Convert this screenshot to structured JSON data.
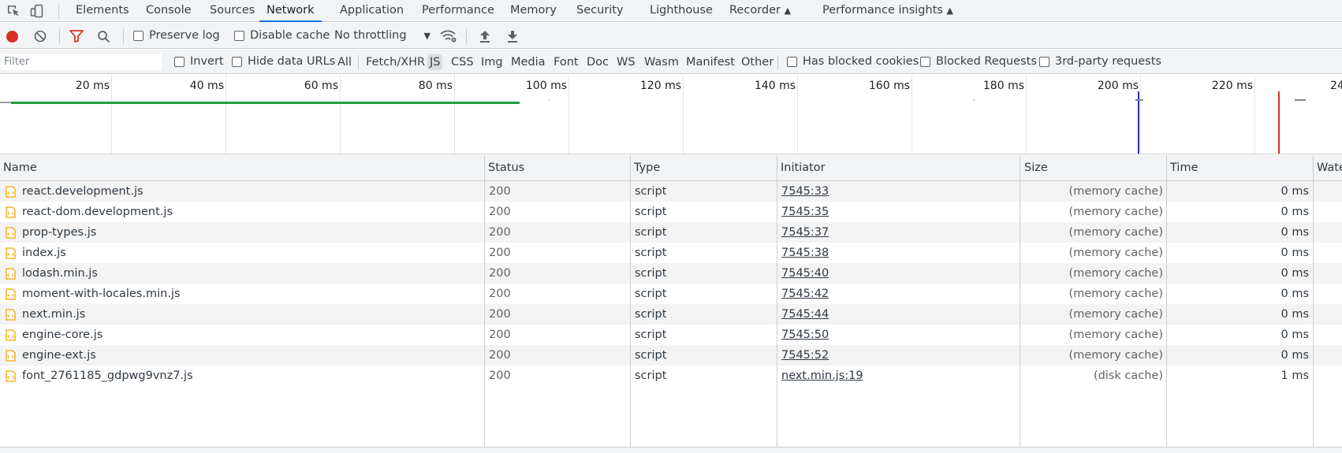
{
  "tabs": [
    {
      "label": "Elements"
    },
    {
      "label": "Console"
    },
    {
      "label": "Sources"
    },
    {
      "label": "Network",
      "active": true
    },
    {
      "label": "Application"
    },
    {
      "label": "Performance"
    },
    {
      "label": "Memory"
    },
    {
      "label": "Security"
    },
    {
      "label": "Lighthouse"
    },
    {
      "label": "Recorder"
    },
    {
      "label": "Performance insights"
    }
  ],
  "toolbar": {
    "preserve_log": "Preserve log",
    "disable_cache": "Disable cache",
    "throttling": "No throttling"
  },
  "filter": {
    "placeholder": "Filter",
    "invert": "Invert",
    "hide_data_urls": "Hide data URLs",
    "types": [
      "All",
      "Fetch/XHR",
      "JS",
      "CSS",
      "Img",
      "Media",
      "Font",
      "Doc",
      "WS",
      "Wasm",
      "Manifest",
      "Other"
    ],
    "active_type": "JS",
    "has_blocked_cookies": "Has blocked cookies",
    "blocked_requests": "Blocked Requests",
    "third_party": "3rd-party requests"
  },
  "timeline": {
    "ticks": [
      "20 ms",
      "40 ms",
      "60 ms",
      "80 ms",
      "100 ms",
      "120 ms",
      "140 ms",
      "160 ms",
      "180 ms",
      "200 ms",
      "220 ms",
      "24"
    ]
  },
  "columns": [
    "Name",
    "Status",
    "Type",
    "Initiator",
    "Size",
    "Time",
    "Wate"
  ],
  "rows": [
    {
      "name": "react.development.js",
      "status": "200",
      "type": "script",
      "initiator": "7545:33",
      "size": "(memory cache)",
      "time": "0 ms"
    },
    {
      "name": "react-dom.development.js",
      "status": "200",
      "type": "script",
      "initiator": "7545:35",
      "size": "(memory cache)",
      "time": "0 ms"
    },
    {
      "name": "prop-types.js",
      "status": "200",
      "type": "script",
      "initiator": "7545:37",
      "size": "(memory cache)",
      "time": "0 ms"
    },
    {
      "name": "index.js",
      "status": "200",
      "type": "script",
      "initiator": "7545:38",
      "size": "(memory cache)",
      "time": "0 ms"
    },
    {
      "name": "lodash.min.js",
      "status": "200",
      "type": "script",
      "initiator": "7545:40",
      "size": "(memory cache)",
      "time": "0 ms"
    },
    {
      "name": "moment-with-locales.min.js",
      "status": "200",
      "type": "script",
      "initiator": "7545:42",
      "size": "(memory cache)",
      "time": "0 ms"
    },
    {
      "name": "next.min.js",
      "status": "200",
      "type": "script",
      "initiator": "7545:44",
      "size": "(memory cache)",
      "time": "0 ms"
    },
    {
      "name": "engine-core.js",
      "status": "200",
      "type": "script",
      "initiator": "7545:50",
      "size": "(memory cache)",
      "time": "0 ms"
    },
    {
      "name": "engine-ext.js",
      "status": "200",
      "type": "script",
      "initiator": "7545:52",
      "size": "(memory cache)",
      "time": "0 ms"
    },
    {
      "name": "font_2761185_gdpwg9vnz7.js",
      "status": "200",
      "type": "script",
      "initiator": "next.min.js:19",
      "size": "(disk cache)",
      "time": "1 ms"
    }
  ],
  "colors": {
    "accent": "#1a73e8",
    "record": "#d93025",
    "filter_icon": "#d93025",
    "timeline_bar": "#1e9e3e",
    "dom_content_loaded": "#2a2ac0",
    "load": "#d93025",
    "file_icon": "#f2a600"
  }
}
